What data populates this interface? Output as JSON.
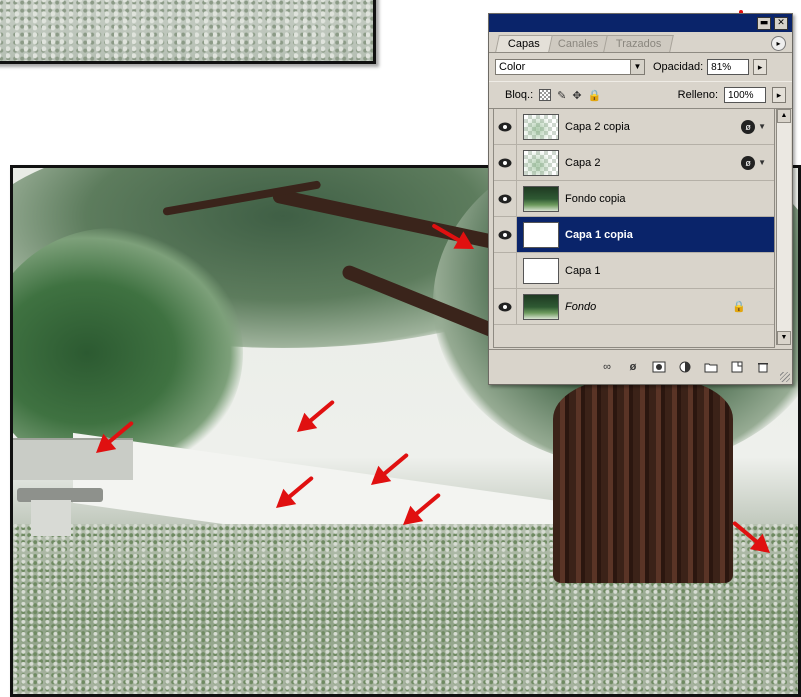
{
  "panel": {
    "tabs": [
      "Capas",
      "Canales",
      "Trazados"
    ],
    "blend_mode": "Color",
    "opacity_label": "Opacidad:",
    "opacity_value": "81%",
    "lock_label": "Bloq.:",
    "fill_label": "Relleno:",
    "fill_value": "100%",
    "layers": [
      {
        "name": "Capa 2 copia",
        "visible": true,
        "thumb": "checker",
        "effects": true
      },
      {
        "name": "Capa 2",
        "visible": true,
        "thumb": "checker",
        "effects": true
      },
      {
        "name": "Fondo copia",
        "visible": true,
        "thumb": "photo"
      },
      {
        "name": "Capa 1 copia",
        "visible": true,
        "thumb": "white",
        "selected": true
      },
      {
        "name": "Capa 1",
        "visible": false,
        "thumb": "white"
      },
      {
        "name": "Fondo",
        "visible": true,
        "thumb": "photo",
        "locked": true
      }
    ],
    "bottom_icons": [
      "link-icon",
      "layer-style-icon",
      "mask-icon",
      "adjustment-icon",
      "group-folder-icon",
      "new-layer-icon",
      "trash-icon"
    ]
  },
  "annotation_color": "#e01010",
  "selection_color": "#0a246a"
}
